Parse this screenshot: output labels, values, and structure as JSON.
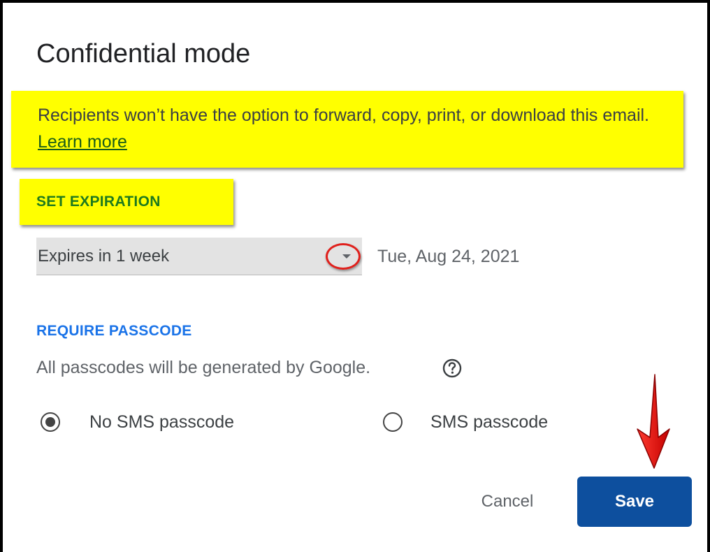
{
  "dialog": {
    "title": "Confidential mode",
    "notice": {
      "text": "Recipients won’t have the option to forward, copy, print, or download this email. ",
      "link": "Learn more"
    },
    "expiration": {
      "section_label": "SET EXPIRATION",
      "selected": "Expires in 1 week",
      "date": "Tue, Aug 24, 2021"
    },
    "passcode": {
      "section_label": "REQUIRE PASSCODE",
      "info": "All passcodes will be generated by Google.",
      "options": [
        {
          "label": "No SMS passcode",
          "selected": true
        },
        {
          "label": "SMS passcode",
          "selected": false
        }
      ]
    },
    "buttons": {
      "cancel": "Cancel",
      "save": "Save"
    }
  },
  "colors": {
    "highlight": "#ffff00",
    "link_green": "#1a5c1a",
    "section_green": "#1e7a1e",
    "section_blue": "#1a73e8",
    "primary_button": "#0d4f9e",
    "annotation_red": "#e0201c"
  },
  "icons": {
    "help": "help-circle-icon",
    "dropdown": "caret-down-icon",
    "annotation_arrow": "arrow-down-icon"
  }
}
